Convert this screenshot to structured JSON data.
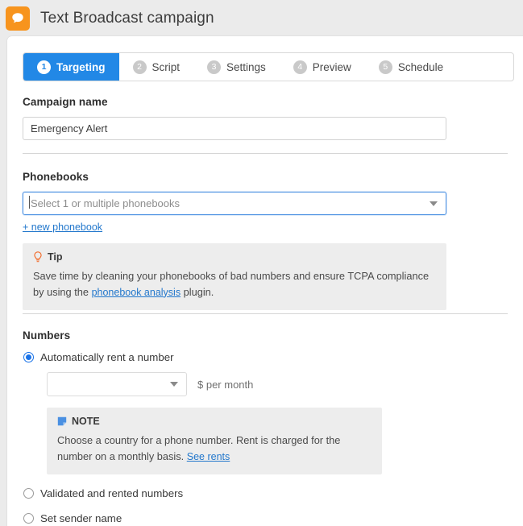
{
  "header": {
    "icon": "chat-bubble-icon",
    "title": "Text Broadcast campaign",
    "icon_color": "#f7941e"
  },
  "tabs": {
    "active_index": 0,
    "items": [
      {
        "num": "1",
        "label": "Targeting"
      },
      {
        "num": "2",
        "label": "Script"
      },
      {
        "num": "3",
        "label": "Settings"
      },
      {
        "num": "4",
        "label": "Preview"
      },
      {
        "num": "5",
        "label": "Schedule"
      }
    ],
    "active_color": "#2288e6"
  },
  "campaign_name": {
    "label": "Campaign name",
    "value": "Emergency Alert",
    "placeholder": "Campaign name"
  },
  "phonebooks": {
    "label": "Phonebooks",
    "placeholder": "Select 1 or multiple phonebooks",
    "selected": "",
    "focused": true,
    "new_link": "+ new phonebook",
    "tip": {
      "icon": "lightbulb-icon",
      "icon_color": "#f26522",
      "title": "Tip",
      "text_before": "Save time by cleaning your phonebooks of bad numbers and ensure TCPA compliance by using the ",
      "link": "phonebook analysis",
      "text_after": " plugin."
    }
  },
  "numbers": {
    "label": "Numbers",
    "options": [
      {
        "label": "Automatically rent a number",
        "checked": true
      },
      {
        "label": "Validated and rented numbers",
        "checked": false
      },
      {
        "label": "Set sender name",
        "checked": false
      }
    ],
    "country_select": {
      "placeholder": "",
      "selected": "",
      "suffix": "$ per month"
    },
    "note": {
      "icon": "note-icon",
      "icon_color": "#4a90e2",
      "title": "NOTE",
      "text_before": "Choose a country for a phone number. Rent is charged for the number on a monthly basis. ",
      "link": "See rents"
    }
  }
}
